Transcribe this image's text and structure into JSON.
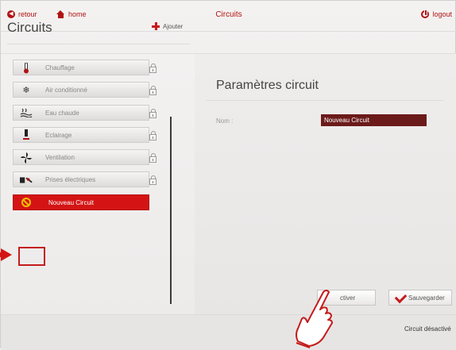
{
  "topbar": {
    "back_label": "retour",
    "home_label": "home",
    "title": "Circuits",
    "logout_label": "logout"
  },
  "left_panel": {
    "title": "Circuits",
    "add_label": "Ajouter",
    "circuits": [
      {
        "label": "Chauffage",
        "icon": "thermometer-icon"
      },
      {
        "label": "Air conditionné",
        "icon": "snowflake-icon"
      },
      {
        "label": "Eau chaude",
        "icon": "hot-water-icon"
      },
      {
        "label": "Eclairage",
        "icon": "lamp-icon"
      },
      {
        "label": "Ventilation",
        "icon": "fan-icon"
      },
      {
        "label": "Prises électriques",
        "icon": "plug-icon"
      },
      {
        "label": "Nouveau Circuit",
        "icon": "ban-icon",
        "selected": true
      }
    ]
  },
  "right_panel": {
    "title": "Paramètres circuit",
    "name_label": "Nom :",
    "name_value": "Nouveau Circuit",
    "activate_label": "ctiver",
    "save_label": "Sauvegarder",
    "status_text": "Circuit désactivé"
  },
  "colors": {
    "accent": "#c41c1c",
    "selected": "#d41414",
    "name_field": "#6b1a1a"
  }
}
